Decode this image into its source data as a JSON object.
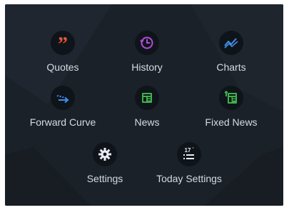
{
  "menu": {
    "items": [
      {
        "id": "quotes",
        "label": "Quotes",
        "icon": "quote-icon",
        "color": "#e2553a"
      },
      {
        "id": "history",
        "label": "History",
        "icon": "clock-icon",
        "color": "#b04dd8"
      },
      {
        "id": "charts",
        "label": "Charts",
        "icon": "chart-line-icon",
        "color": "#3f8fe8"
      },
      {
        "id": "forward-curve",
        "label": "Forward Curve",
        "icon": "forward-curve-icon",
        "color": "#3f8fe8"
      },
      {
        "id": "news",
        "label": "News",
        "icon": "newspaper-icon",
        "color": "#3fb24a"
      },
      {
        "id": "fixed-news",
        "label": "Fixed News",
        "icon": "pinned-news-icon",
        "color": "#3fb24a"
      },
      {
        "id": "settings",
        "label": "Settings",
        "icon": "gear-icon",
        "color": "#e8ecf0"
      },
      {
        "id": "today-settings",
        "label": "Today Settings",
        "icon": "today-list-icon",
        "color": "#e8ecf0",
        "badge_text": "17"
      }
    ]
  }
}
